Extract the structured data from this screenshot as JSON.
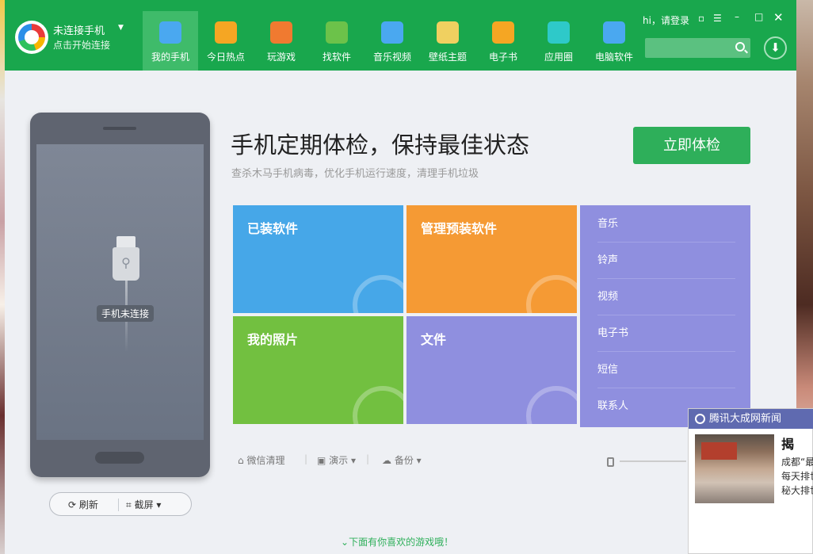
{
  "header": {
    "connection_title": "未连接手机",
    "connection_subtitle": "点击开始连接",
    "nav": [
      {
        "label": "我的手机",
        "color": "#4aa8f0",
        "active": true
      },
      {
        "label": "今日热点",
        "color": "#f5a623",
        "active": false
      },
      {
        "label": "玩游戏",
        "color": "#f07a30",
        "active": false
      },
      {
        "label": "找软件",
        "color": "#6cc24a",
        "active": false
      },
      {
        "label": "音乐视频",
        "color": "#4aa8f0",
        "active": false
      },
      {
        "label": "壁纸主题",
        "color": "#f0d060",
        "active": false
      },
      {
        "label": "电子书",
        "color": "#f5a623",
        "active": false
      },
      {
        "label": "应用圈",
        "color": "#2ec9c9",
        "active": false
      },
      {
        "label": "电脑软件",
        "color": "#4aa8f0",
        "active": false
      }
    ],
    "login": "hi，请登录",
    "search_placeholder": ""
  },
  "phone": {
    "status": "手机未连接",
    "refresh": "刷新",
    "screenshot": "截屏"
  },
  "main": {
    "title": "手机定期体检，保持最佳状态",
    "subtitle": "查杀木马手机病毒，优化手机运行速度，清理手机垃圾",
    "checkup_button": "立即体检",
    "tiles": [
      {
        "label": "已装软件",
        "color": "#46a7e8"
      },
      {
        "label": "管理预装软件",
        "color": "#f59a34"
      },
      {
        "label": "我的照片",
        "color": "#72c040"
      },
      {
        "label": "文件",
        "color": "#8f8fdf"
      }
    ],
    "media_items": [
      "音乐",
      "铃声",
      "视频",
      "电子书",
      "短信",
      "联系人"
    ],
    "toolbar": {
      "wechat": "微信清理",
      "demo": "演示",
      "backup": "备份"
    },
    "more_games": "下面有你喜欢的游戏哦！"
  },
  "popup": {
    "title": "腾讯大成网新闻",
    "headline": "揭",
    "body_lines": [
      "成都“最",
      "每天排世",
      "秘大排世"
    ]
  }
}
